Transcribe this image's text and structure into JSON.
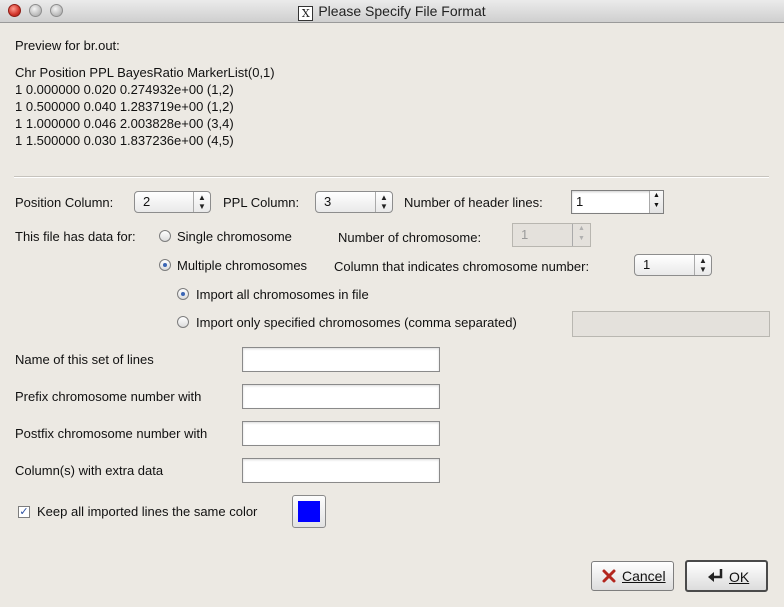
{
  "window": {
    "title": "Please Specify File Format",
    "title_icon": "X"
  },
  "preview": {
    "label": "Preview for br.out:",
    "lines": [
      "Chr Position PPL BayesRatio MarkerList(0,1)",
      "1 0.000000 0.020 0.274932e+00 (1,2)",
      "1 0.500000 0.040 1.283719e+00 (1,2)",
      "1 1.000000 0.046 2.003828e+00 (3,4)",
      "1 1.500000 0.030 1.837236e+00 (4,5)"
    ]
  },
  "columns": {
    "position_label": "Position Column:",
    "position_value": "2",
    "ppl_label": "PPL Column:",
    "ppl_value": "3",
    "header_lines_label": "Number of header lines:",
    "header_lines_value": "1"
  },
  "data_for": {
    "label": "This file has data for:",
    "single_label": "Single chromosome",
    "single_selected": false,
    "num_chrom_label": "Number of chromosome:",
    "num_chrom_value": "1",
    "multiple_label": "Multiple chromosomes",
    "multiple_selected": true,
    "col_indicates_label": "Column that indicates chromosome number:",
    "col_indicates_value": "1",
    "import_all_label": "Import all chromosomes in file",
    "import_all_selected": true,
    "import_specified_label": "Import only specified chromosomes (comma separated)",
    "import_specified_selected": false,
    "import_specified_value": ""
  },
  "fields": [
    {
      "label": "Name of this set of lines",
      "value": ""
    },
    {
      "label": "Prefix chromosome number with",
      "value": ""
    },
    {
      "label": "Postfix chromosome number with",
      "value": ""
    },
    {
      "label": "Column(s) with extra data",
      "value": ""
    }
  ],
  "color": {
    "checkbox_label": "Keep all imported lines the same color",
    "checked": true,
    "swatch": "#0000ff"
  },
  "buttons": {
    "cancel_icon": "x-icon",
    "cancel_label": "Cancel",
    "ok_icon": "return-arrow-icon",
    "ok_label": "OK"
  }
}
